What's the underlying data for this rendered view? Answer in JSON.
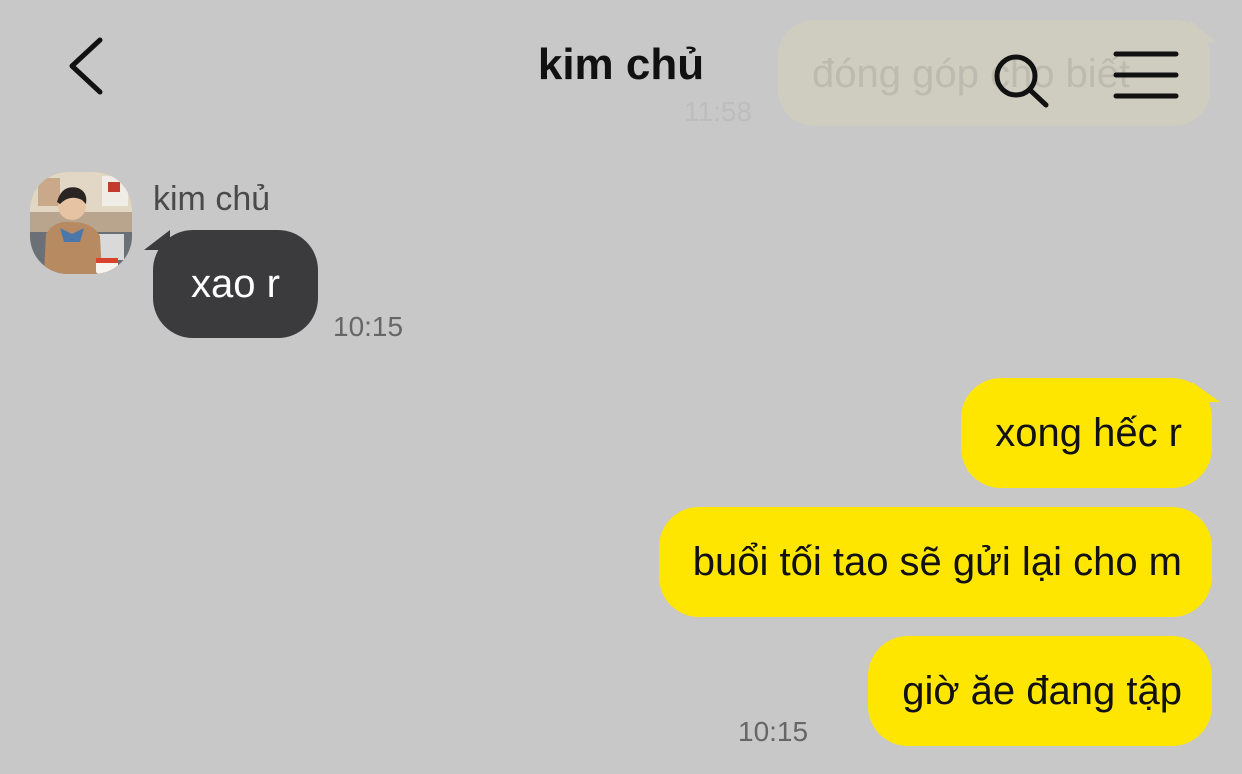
{
  "header": {
    "title": "kim chủ",
    "back_icon": "chevron-left-icon",
    "search_icon": "search-icon",
    "menu_icon": "hamburger-menu-icon"
  },
  "previous_message": {
    "text": "đóng góp cho biết",
    "time": "11:58"
  },
  "incoming": {
    "sender": "kim chủ",
    "messages": [
      {
        "text": "xao r"
      }
    ],
    "time": "10:15"
  },
  "outgoing": {
    "messages": [
      {
        "text": "xong hếc r"
      },
      {
        "text": "buổi tối tao sẽ gửi lại cho m"
      },
      {
        "text": "giờ ăe đang tập"
      }
    ],
    "time": "10:15"
  },
  "colors": {
    "background": "#c8c8c8",
    "outgoing_bubble": "#ffe600",
    "incoming_bubble": "#3b3b3d"
  }
}
